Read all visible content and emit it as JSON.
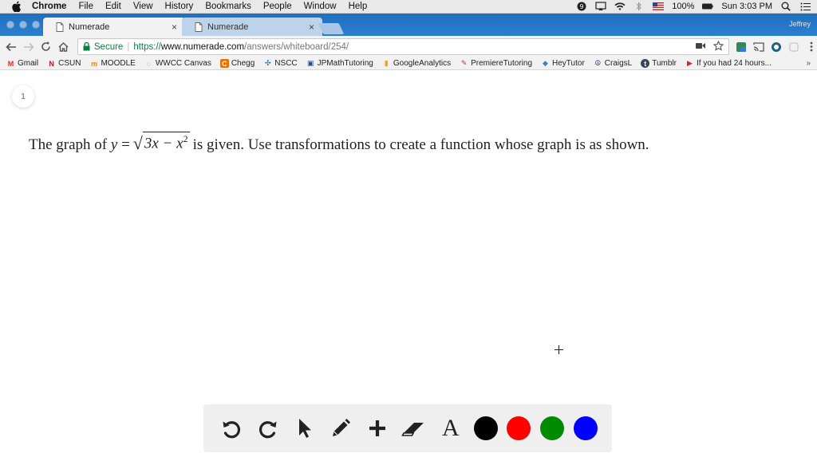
{
  "menubar": {
    "items": [
      "Chrome",
      "File",
      "Edit",
      "View",
      "History",
      "Bookmarks",
      "People",
      "Window",
      "Help"
    ],
    "battery": "100%",
    "clock": "Sun 3:03 PM"
  },
  "tabs": [
    {
      "title": "Numerade",
      "close": "×"
    },
    {
      "title": "Numerade",
      "close": "×"
    }
  ],
  "profile_label": "Jeffrey",
  "address_bar": {
    "secure_label": "Secure",
    "scheme": "https://",
    "host": "www.numerade.com",
    "path": "/answers/whiteboard/254/"
  },
  "bookmarks": [
    {
      "label": "Gmail",
      "icon": "M",
      "color": "#d93025"
    },
    {
      "label": "CSUN",
      "icon": "N",
      "color": "#b31b1b"
    },
    {
      "label": "MOODLE",
      "icon": "m",
      "color": "#f98012"
    },
    {
      "label": "WWCC Canvas",
      "icon": "◌",
      "color": "#d64527"
    },
    {
      "label": "Chegg",
      "icon": "C",
      "color": "#eb7100"
    },
    {
      "label": "NSCC",
      "icon": "✣",
      "color": "#1a5fa8"
    },
    {
      "label": "JPMathTutoring",
      "icon": "▣",
      "color": "#2c4f8c"
    },
    {
      "label": "GoogleAnalytics",
      "icon": "▮",
      "color": "#f4a00a"
    },
    {
      "label": "PremiereTutoring",
      "icon": "✎",
      "color": "#b33b3b"
    },
    {
      "label": "HeyTutor",
      "icon": "◆",
      "color": "#3a7bd5"
    },
    {
      "label": "CraigsL",
      "icon": "☮",
      "color": "#5a2a82"
    },
    {
      "label": "Tumblr",
      "icon": "t",
      "color": "#35465c"
    },
    {
      "label": "If you had 24 hours...",
      "icon": "▶",
      "color": "#e62117"
    }
  ],
  "bookmarks_more": "»",
  "whiteboard": {
    "page_number": "1",
    "problem_prefix": "The graph of",
    "var_y": "y",
    "equals": "=",
    "radicand": "3x − x",
    "exponent": "2",
    "problem_suffix": "is given. Use transformations to create a function whose graph is as shown."
  },
  "draw_tools": [
    "undo",
    "redo",
    "select",
    "pen",
    "add",
    "eraser",
    "text"
  ],
  "text_tool_label": "A",
  "colors": {
    "black": "#000000",
    "red": "#ff0000",
    "green": "#008a00",
    "blue": "#0000ff"
  }
}
